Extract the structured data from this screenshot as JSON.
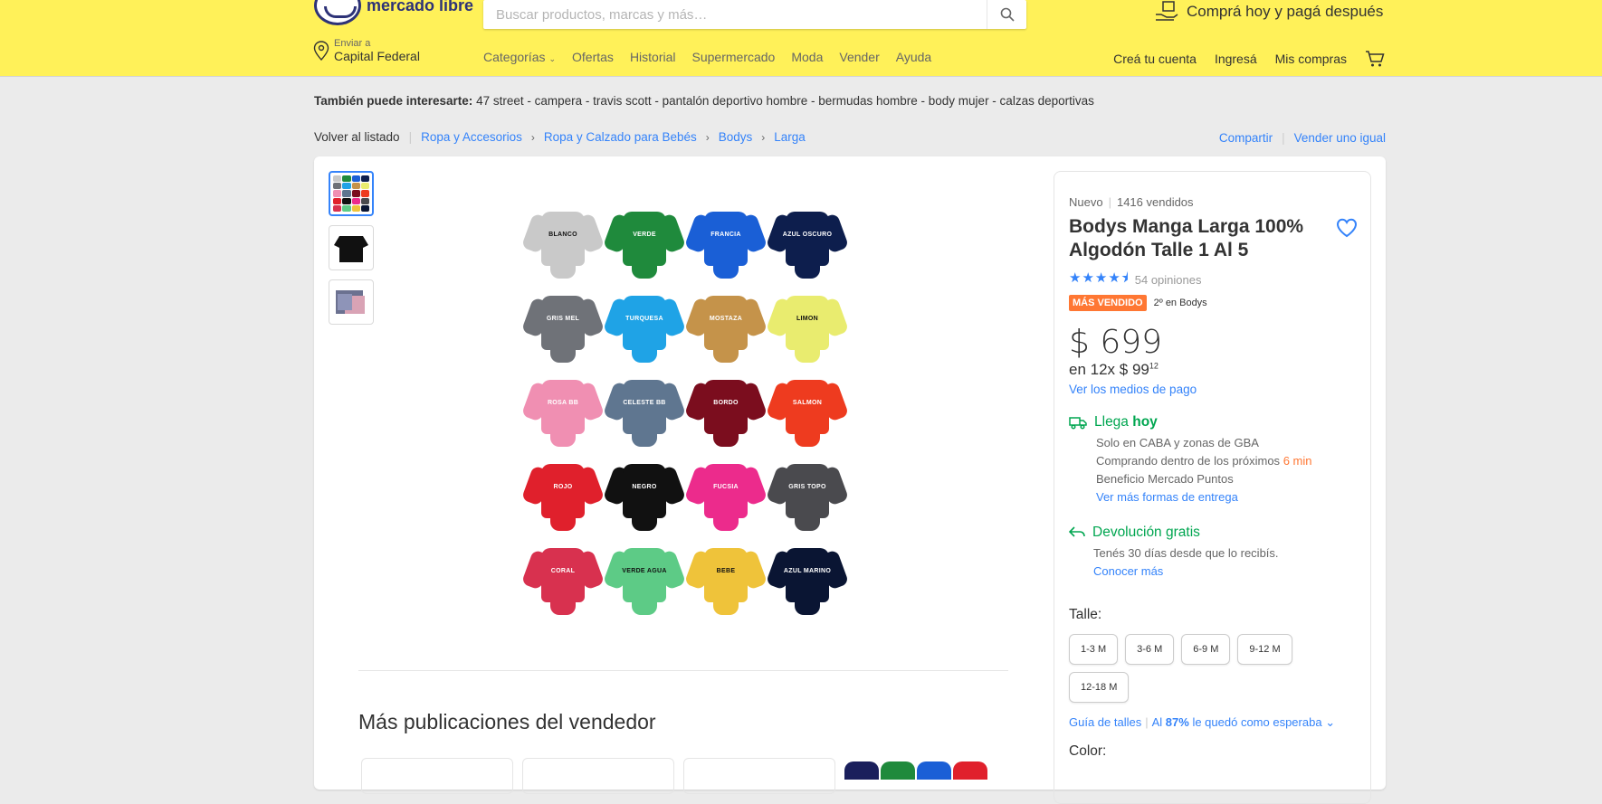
{
  "header": {
    "logo_text": "mercado libre",
    "search_placeholder": "Buscar productos, marcas y más…",
    "promo": "Comprá hoy y pagá después",
    "location_small": "Enviar a",
    "location": "Capital Federal",
    "nav": [
      "Categorías",
      "Ofertas",
      "Historial",
      "Supermercado",
      "Moda",
      "Vender",
      "Ayuda"
    ],
    "user_nav": [
      "Creá tu cuenta",
      "Ingresá",
      "Mis compras"
    ]
  },
  "suggestions": {
    "label": "También puede interesarte:",
    "items": "47 street - campera - travis scott - pantalón deportivo hombre - bermudas hombre - body mujer - calzas deportivas"
  },
  "breadcrumbs": {
    "back": "Volver al listado",
    "items": [
      "Ropa y Accesorios",
      "Ropa y Calzado para Bebés",
      "Bodys",
      "Larga"
    ]
  },
  "actions": {
    "share": "Compartir",
    "sell": "Vender uno igual"
  },
  "product": {
    "condition": "Nuevo",
    "sold": "1416 vendidos",
    "title": "Bodys Manga Larga 100% Algodón Talle 1 Al 5",
    "rating_stars": 4.5,
    "reviews": "54 opiniones",
    "badge": "MÁS VENDIDO",
    "rank": "2º en Bodys",
    "price": "$ 699",
    "installments_prefix": "en 12x $ 99",
    "installments_cents": "12",
    "payment_link": "Ver los medios de pago",
    "shipping_title_1": "Llega",
    "shipping_title_2": "hoy",
    "shipping_line1": "Solo en CABA y zonas de GBA",
    "shipping_line2_prefix": "Comprando dentro de los próximos",
    "shipping_line2_time": "6 min",
    "shipping_line3": "Beneficio Mercado Puntos",
    "shipping_link": "Ver más formas de entrega",
    "return_title": "Devolución gratis",
    "return_line": "Tenés 30 días desde que lo recibís.",
    "return_link": "Conocer más",
    "size_label": "Talle:",
    "sizes": [
      "1-3 M",
      "3-6 M",
      "6-9 M",
      "9-12 M",
      "12-18 M"
    ],
    "guide_link": "Guía de talles",
    "guide_pct_prefix": "Al",
    "guide_pct": "87%",
    "guide_pct_suffix": "le quedó como esperaba",
    "color_label": "Color:"
  },
  "gallery": {
    "bodies": [
      {
        "color": "#c9c9c9",
        "text": "BLANCO",
        "ink": "#111"
      },
      {
        "color": "#1f8a3c",
        "text": "VERDE",
        "ink": "#fff"
      },
      {
        "color": "#1a5fd6",
        "text": "FRANCIA",
        "ink": "#fff"
      },
      {
        "color": "#0d1e4d",
        "text": "AZUL OSCURO",
        "ink": "#fff"
      },
      {
        "color": "#6f7278",
        "text": "GRIS MEL",
        "ink": "#fff"
      },
      {
        "color": "#1fa3e6",
        "text": "TURQUESA",
        "ink": "#fff"
      },
      {
        "color": "#c5934a",
        "text": "MOSTAZA",
        "ink": "#fff"
      },
      {
        "color": "#e9ec6f",
        "text": "LIMON",
        "ink": "#111"
      },
      {
        "color": "#f08fb2",
        "text": "ROSA BB",
        "ink": "#fff"
      },
      {
        "color": "#5f7690",
        "text": "CELESTE BB",
        "ink": "#fff"
      },
      {
        "color": "#7b0d1e",
        "text": "BORDO",
        "ink": "#fff"
      },
      {
        "color": "#ee3b1f",
        "text": "SALMON",
        "ink": "#fff"
      },
      {
        "color": "#e0202c",
        "text": "ROJO",
        "ink": "#fff"
      },
      {
        "color": "#111111",
        "text": "NEGRO",
        "ink": "#fff"
      },
      {
        "color": "#ec2b8c",
        "text": "FUCSIA",
        "ink": "#fff"
      },
      {
        "color": "#4a4a4e",
        "text": "GRIS TOPO",
        "ink": "#fff"
      },
      {
        "color": "#d8314f",
        "text": "CORAL",
        "ink": "#fff"
      },
      {
        "color": "#5dcb86",
        "text": "VERDE AGUA",
        "ink": "#111"
      },
      {
        "color": "#efc33a",
        "text": "BEBE",
        "ink": "#111"
      },
      {
        "color": "#0a1533",
        "text": "AZUL MARINO",
        "ink": "#fff"
      }
    ]
  },
  "more": {
    "title": "Más publicaciones del vendedor"
  },
  "colors": {
    "accent": "#3483fa",
    "header": "#fff159",
    "green": "#00a650",
    "badge": "#ff7733"
  }
}
